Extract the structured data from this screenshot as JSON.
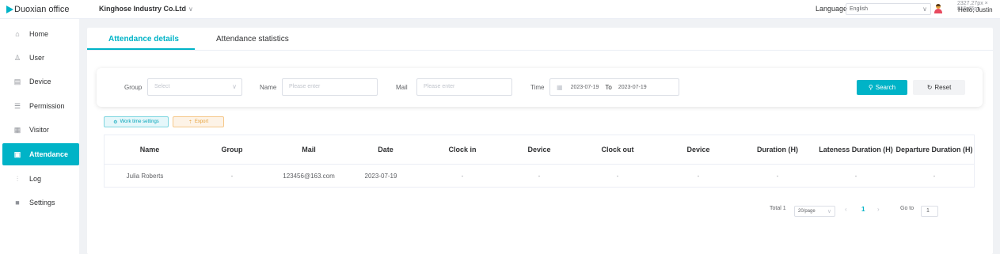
{
  "app": {
    "logo_text": "Duoxian office",
    "company": "Kinghose Industry Co.Ltd"
  },
  "header": {
    "language_label": "Language",
    "language_value": "English",
    "dimensions_text": "2327.27px × 815.45px",
    "greeting": "Hello, Justin"
  },
  "sidebar": {
    "items": [
      {
        "label": "Home",
        "icon": "home-icon",
        "active": false
      },
      {
        "label": "User",
        "icon": "user-icon",
        "active": false
      },
      {
        "label": "Device",
        "icon": "device-icon",
        "active": false
      },
      {
        "label": "Permission",
        "icon": "permission-icon",
        "active": false
      },
      {
        "label": "Visitor",
        "icon": "visitor-icon",
        "active": false
      },
      {
        "label": "Attendance",
        "icon": "attendance-icon",
        "active": true
      },
      {
        "label": "Log",
        "icon": "log-icon",
        "active": false
      },
      {
        "label": "Settings",
        "icon": "settings-icon",
        "active": false
      }
    ]
  },
  "tabs": [
    {
      "label": "Attendance details",
      "active": true
    },
    {
      "label": "Attendance statistics",
      "active": false
    }
  ],
  "filters": {
    "group_label": "Group",
    "group_placeholder": "Select",
    "name_label": "Name",
    "name_placeholder": "Please enter",
    "mail_label": "Mail",
    "mail_placeholder": "Please enter",
    "time_label": "Time",
    "date_from": "2023-07-19",
    "date_to_label": "To",
    "date_to": "2023-07-19",
    "search_label": "Search",
    "reset_label": "Reset"
  },
  "actions": {
    "work_time_label": "Work time settings",
    "export_label": "Export"
  },
  "table": {
    "columns": [
      "Name",
      "Group",
      "Mail",
      "Date",
      "Clock in",
      "Device",
      "Clock out",
      "Device",
      "Duration (H)",
      "Lateness Duration (H)",
      "Departure Duration (H)"
    ],
    "rows": [
      [
        "Julia Roberts",
        "-",
        "123456@163.com",
        "2023-07-19",
        "-",
        "-",
        "-",
        "-",
        "-",
        "-",
        "-"
      ]
    ]
  },
  "pagination": {
    "total_text": "Total 1",
    "page_size": "20/page",
    "current_page": "1",
    "goto_label": "Go to",
    "goto_value": "1"
  },
  "colors": {
    "accent": "#00b3c7",
    "export": "#e6a23c",
    "background": "#f0f2f5"
  }
}
